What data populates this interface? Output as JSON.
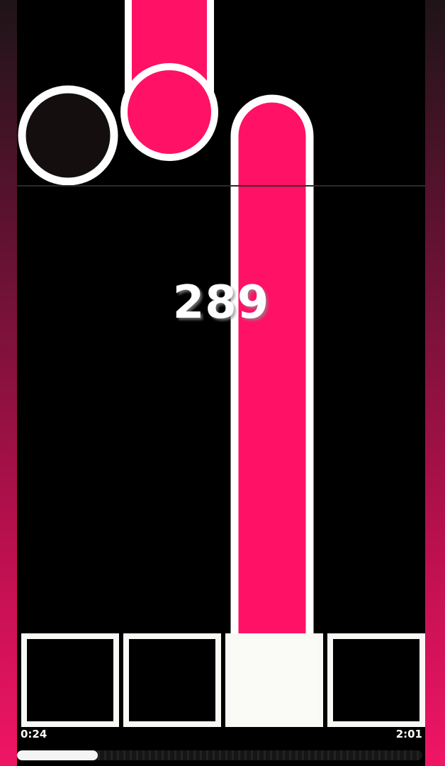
{
  "game": {
    "score": "289",
    "time_elapsed": "0:24",
    "time_total": "2:01",
    "progress": 0.2,
    "lane_count": 4,
    "active_lane": 3
  },
  "colors": {
    "note_pink": "#ff1166",
    "note_outline": "#ffffff",
    "empty_note": "#140e0f",
    "side_gradient_top": "#1e1418",
    "side_gradient_bottom": "#f01565"
  },
  "keys": [
    {
      "name": "lane-1-key",
      "pressed": false
    },
    {
      "name": "lane-2-key",
      "pressed": false
    },
    {
      "name": "lane-3-key",
      "pressed": true
    },
    {
      "name": "lane-4-key",
      "pressed": false
    }
  ]
}
